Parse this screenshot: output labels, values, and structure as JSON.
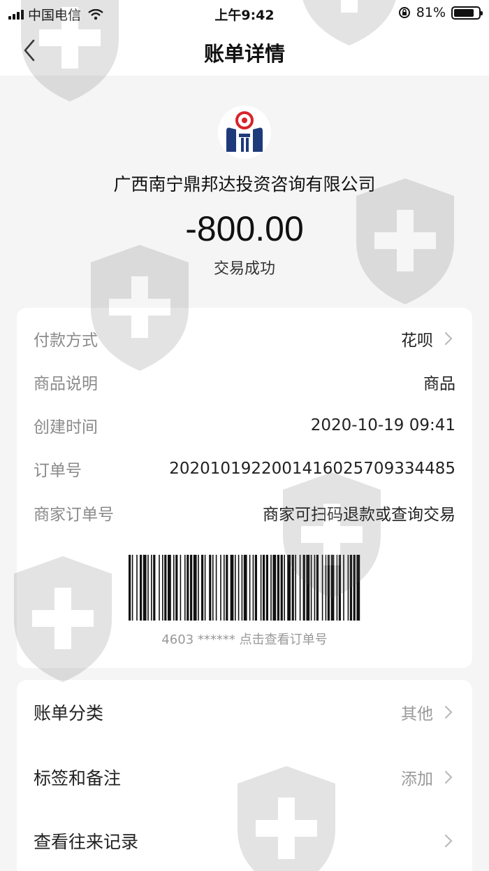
{
  "status_bar": {
    "carrier": "中国电信",
    "time": "上午9:42",
    "battery": "81%",
    "battery_level": 0.81
  },
  "nav": {
    "title": "账单详情",
    "back_icon": "chevron-left-icon"
  },
  "header": {
    "merchant_name": "广西南宁鼎邦达投资咨询有限公司",
    "amount": "-800.00",
    "status": "交易成功"
  },
  "details": {
    "rows": [
      {
        "label": "付款方式",
        "value": "花呗"
      },
      {
        "label": "商品说明",
        "value": "商品"
      },
      {
        "label": "创建时间",
        "value": "2020-10-19 09:41"
      },
      {
        "label": "订单号",
        "value": "2020101922001416025709334485"
      },
      {
        "label": "商家订单号",
        "value": "商家可扫码退款或查询交易"
      }
    ],
    "barcode_caption": "4603 ****** 点击查看订单号"
  },
  "actions": {
    "rows": [
      {
        "label": "账单分类",
        "value": "其他"
      },
      {
        "label": "标签和备注",
        "value": "添加"
      },
      {
        "label": "查看往来记录",
        "value": ""
      }
    ]
  },
  "colors": {
    "background": "#f5f5f5",
    "card": "#ffffff",
    "label_gray": "#8a8a8a",
    "logo_blue": "#1f3a7a",
    "logo_red": "#d8232a"
  }
}
